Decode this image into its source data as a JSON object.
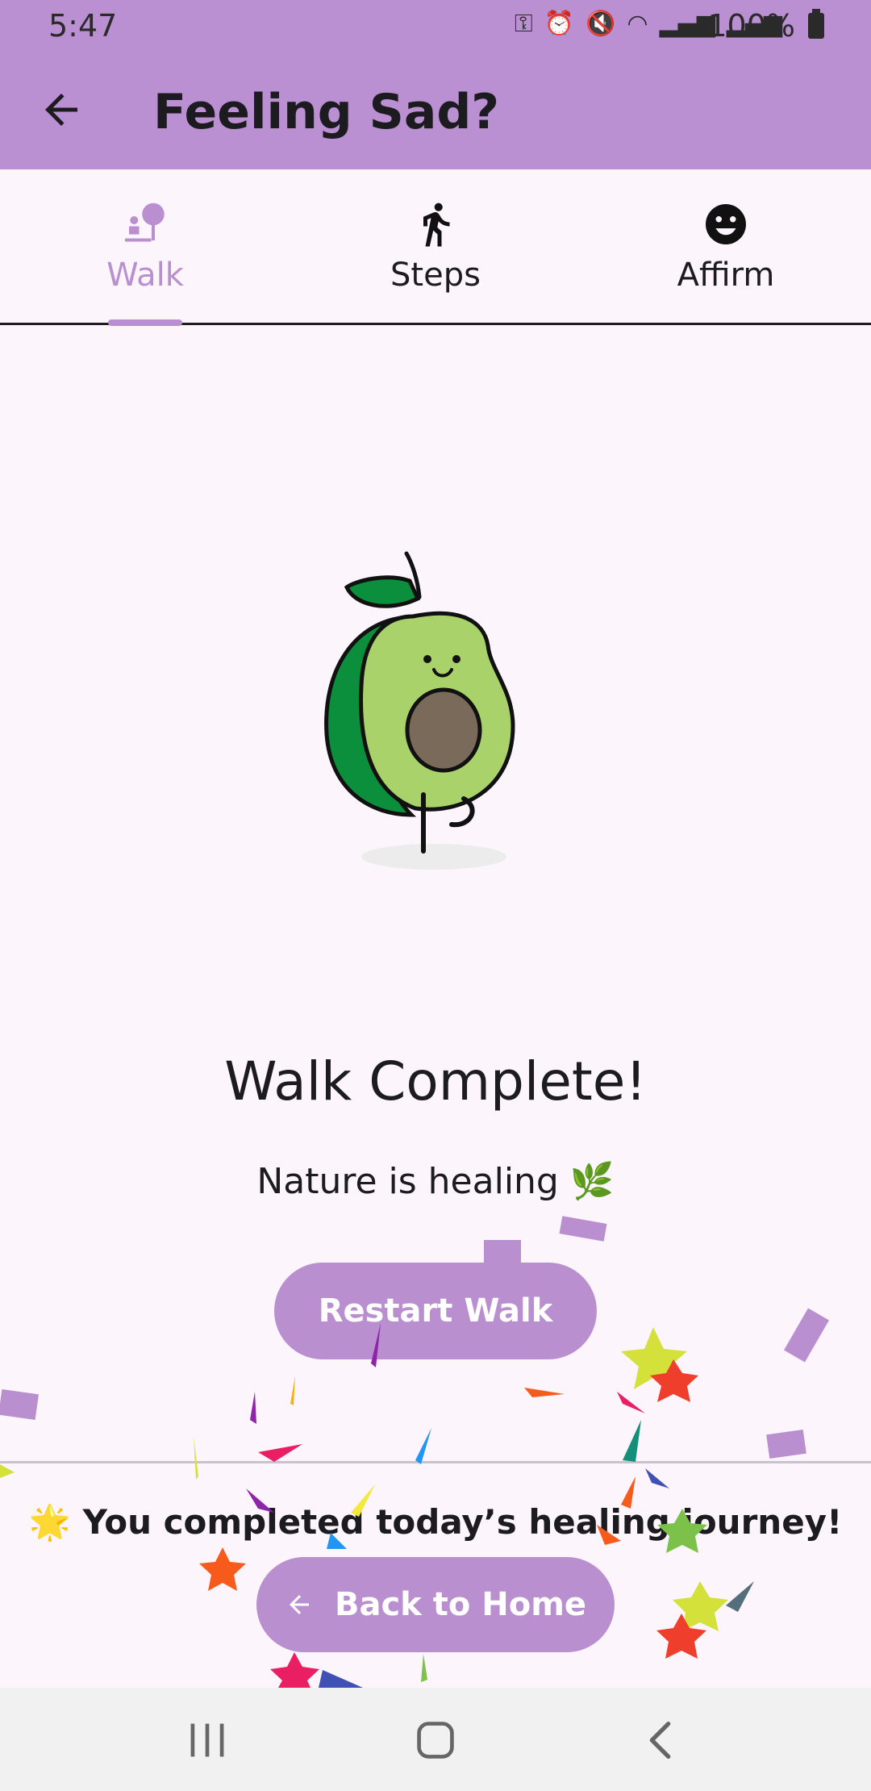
{
  "status": {
    "time": "5:47",
    "battery": "100%",
    "icons": [
      "key-icon",
      "alarm-icon",
      "mute-icon",
      "wifi-icon",
      "signal-icon",
      "volte-icon",
      "signal2-icon",
      "battery-icon"
    ]
  },
  "app_bar": {
    "title": "Feeling Sad?"
  },
  "tabs": [
    {
      "label": "Walk",
      "icon": "walk-park-icon",
      "selected": true
    },
    {
      "label": "Steps",
      "icon": "walking-person-icon",
      "selected": false
    },
    {
      "label": "Affirm",
      "icon": "smiley-icon",
      "selected": false
    }
  ],
  "main": {
    "headline": "Walk Complete!",
    "subline": "Nature is healing 🌿",
    "restart_label": "Restart Walk"
  },
  "footer": {
    "journey_text": "🌟 You completed today’s healing journey!",
    "home_label": "Back to Home"
  },
  "colors": {
    "accent": "#b98fd0",
    "header": "#bb90d2",
    "background": "#fdf5fc"
  }
}
